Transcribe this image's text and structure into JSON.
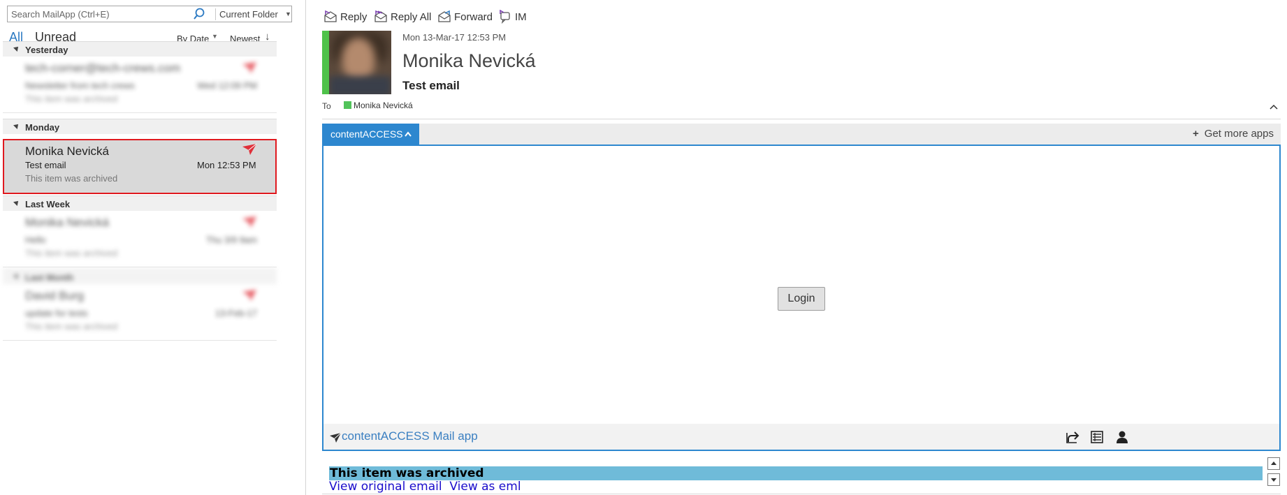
{
  "search": {
    "placeholder": "Search MailApp (Ctrl+E)",
    "scope": "Current Folder"
  },
  "filters": {
    "all": "All",
    "unread": "Unread",
    "sort": "By Date",
    "order": "Newest"
  },
  "groups": {
    "yesterday": "Yesterday",
    "monday": "Monday",
    "last_week": "Last Week",
    "last_month": "Last Month"
  },
  "messages": {
    "yesterday_item": {
      "sender": "tech-corner@tech-crews.com",
      "subject": "Newsletter from tech crews",
      "date": "Wed 12:09 PM",
      "preview": "This item was archived"
    },
    "selected": {
      "sender": "Monika Nevická",
      "subject": "Test email",
      "date": "Mon 12:53 PM",
      "preview": "This item was archived"
    },
    "last_week_item": {
      "sender": "Monika Nevická",
      "subject": "Hello",
      "date": "Thu 3/9 9am",
      "preview": "This item was archived"
    },
    "last_month_item": {
      "sender": "David Burg",
      "subject": "update for tests",
      "date": "13-Feb-17",
      "preview": "This item was archived"
    }
  },
  "toolbar": {
    "reply": "Reply",
    "reply_all": "Reply All",
    "forward": "Forward",
    "im": "IM"
  },
  "reading": {
    "date": "Mon 13-Mar-17 12:53 PM",
    "sender": "Monika Nevická",
    "subject": "Test email",
    "to_label": "To",
    "to_name": "Monika Nevická"
  },
  "addin": {
    "tab": "contentACCESS",
    "get_more": "Get more apps",
    "login": "Login",
    "footer_name": "contentACCESS Mail app"
  },
  "body": {
    "archived": "This item was archived",
    "links": "View original email  View as eml"
  },
  "colors": {
    "accent": "#2d87cf",
    "selection_border": "#e0191f",
    "archived_bg": "#6fbbd9",
    "presence": "#52c35a"
  }
}
